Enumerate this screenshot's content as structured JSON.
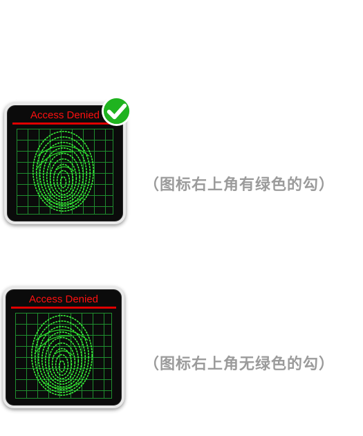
{
  "items": [
    {
      "card_title": "Access Denied",
      "heading": "",
      "caption": "（图标右上角有绿色的勾）",
      "has_check": true
    },
    {
      "card_title": "Access Denied",
      "heading": "",
      "caption": "（图标右上角无绿色的勾）",
      "has_check": false
    }
  ],
  "colors": {
    "title_red": "#ff1010",
    "grid_green": "#1f8f2f",
    "fingerprint_green": "#3cff3c",
    "check_green": "#1fb31f",
    "caption_gray": "#9b9b9b"
  },
  "icons": {
    "fingerprint": "fingerprint-icon",
    "check": "check-icon"
  }
}
